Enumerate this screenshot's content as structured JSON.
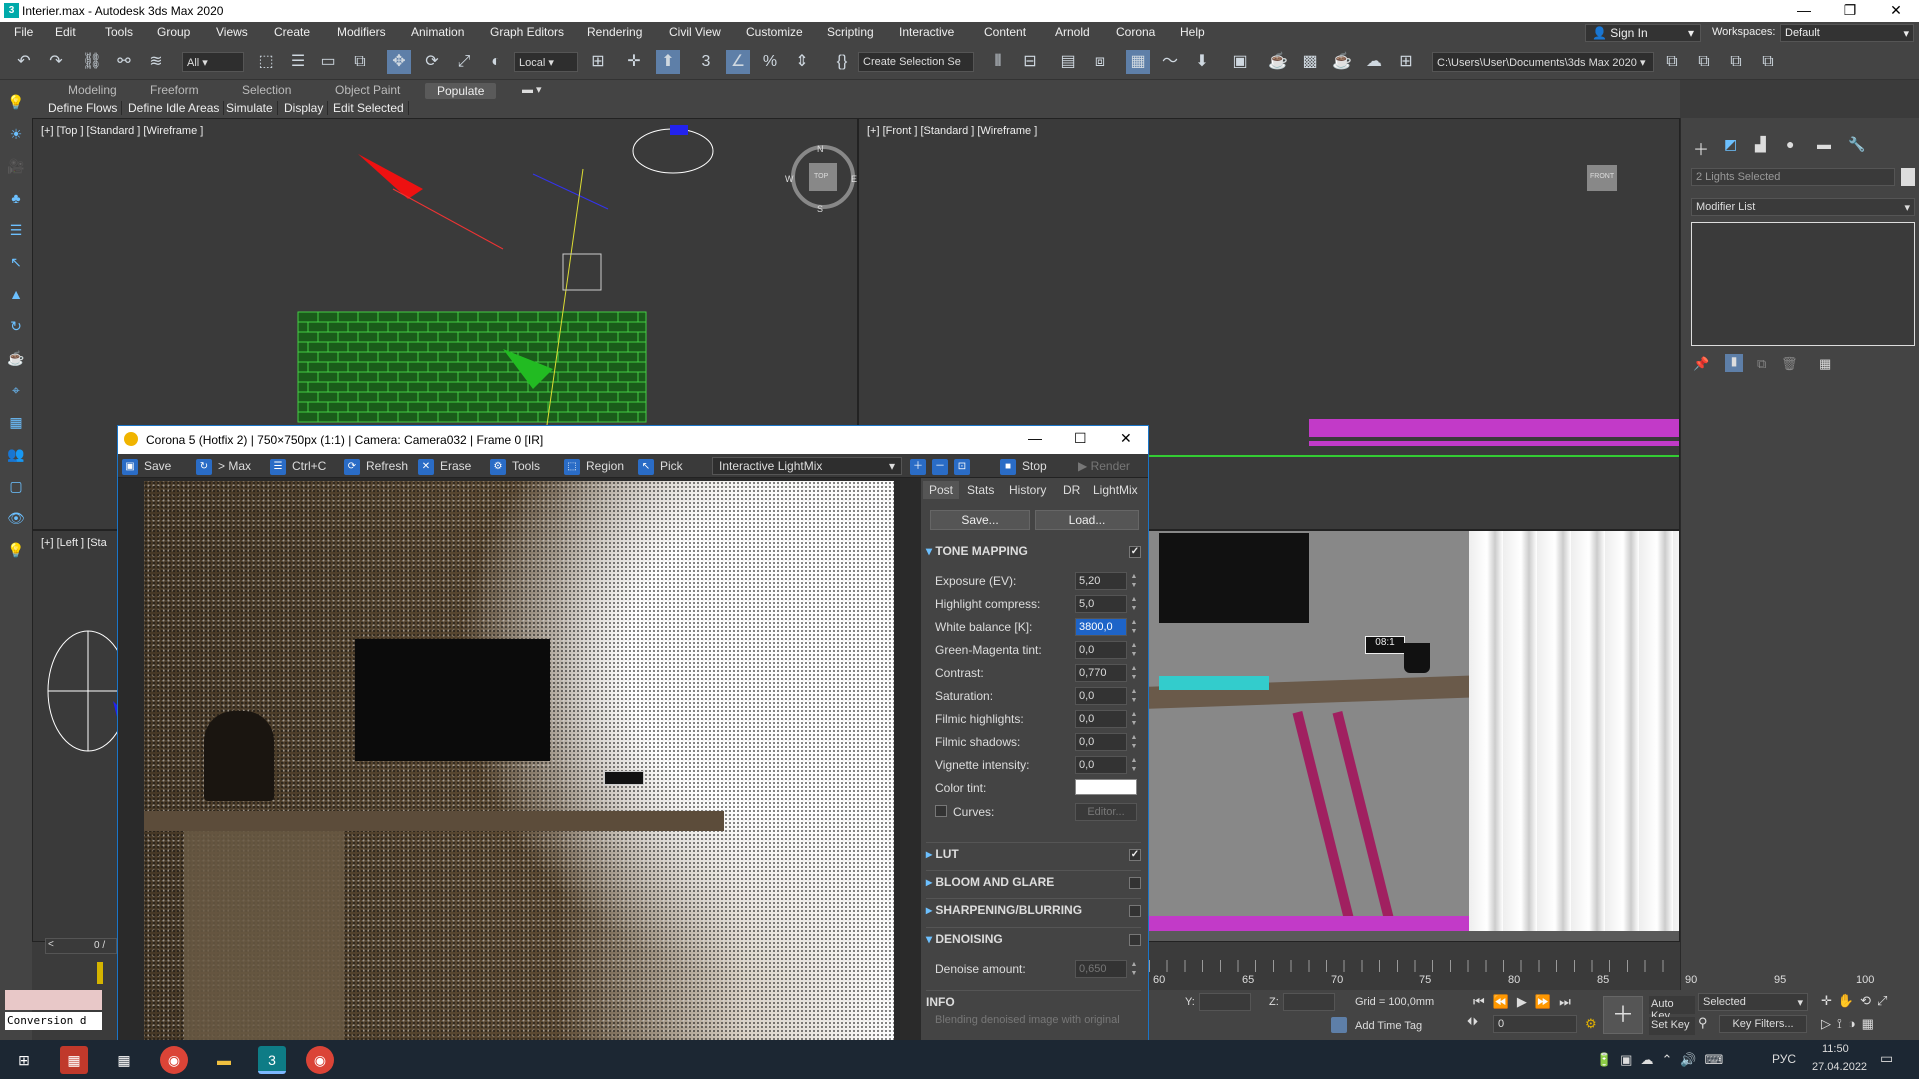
{
  "app": {
    "title": "Interier.max - Autodesk 3ds Max 2020",
    "window_controls": {
      "minimize": "—",
      "restore": "❐",
      "close": "✕"
    }
  },
  "menubar": {
    "items": [
      "File",
      "Edit",
      "Tools",
      "Group",
      "Views",
      "Create",
      "Modifiers",
      "Animation",
      "Graph Editors",
      "Rendering",
      "Civil View",
      "Customize",
      "Scripting",
      "Interactive",
      "Content",
      "Arnold",
      "Corona",
      "Help"
    ],
    "sign_in": "Sign In",
    "workspaces_label": "Workspaces:",
    "workspaces_value": "Default"
  },
  "toolbar": {
    "filter": "All",
    "coord": "Local",
    "selection_set": "Create Selection Se",
    "project_path": "C:\\Users\\User\\Documents\\3ds Max 2020"
  },
  "ribbon": {
    "tabs": [
      "Modeling",
      "Freeform",
      "Selection",
      "Object Paint",
      "Populate"
    ],
    "active_tab": "Populate",
    "sub_items": [
      "Define Flows",
      "Define Idle Areas",
      "Simulate",
      "Display",
      "Edit Selected"
    ]
  },
  "viewports": {
    "top": "[+] [Top ] [Standard ] [Wireframe ]",
    "front": "[+] [Front ] [Standard ] [Wireframe ]",
    "left": "[+] [Left ] [Sta",
    "compass": {
      "n": "N",
      "s": "S",
      "w": "W",
      "e": "E",
      "cube": "TOP"
    },
    "front_cube": "FRONT"
  },
  "cmdpanel": {
    "selection": "2 Lights Selected",
    "modifier_list": "Modifier List"
  },
  "corona": {
    "title": "Corona 5 (Hotfix 2) | 750×750px (1:1) | Camera: Camera032 | Frame 0 [IR]",
    "toolbar": {
      "save": "Save",
      "to_max": "> Max",
      "copy": "Ctrl+C",
      "refresh": "Refresh",
      "erase": "Erase",
      "tools": "Tools",
      "region": "Region",
      "pick": "Pick",
      "lightmix": "Interactive LightMix",
      "stop": "Stop",
      "render": "Render"
    },
    "tabs": [
      "Post",
      "Stats",
      "History",
      "DR",
      "LightMix"
    ],
    "active_tab": "Post",
    "buttons": {
      "save": "Save...",
      "load": "Load..."
    },
    "tone_mapping": {
      "title": "TONE MAPPING",
      "enabled": true,
      "rows": [
        {
          "label": "Exposure (EV):",
          "value": "5,20"
        },
        {
          "label": "Highlight compress:",
          "value": "5,0"
        },
        {
          "label": "White balance [K]:",
          "value": "3800,0"
        },
        {
          "label": "Green-Magenta tint:",
          "value": "0,0"
        },
        {
          "label": "Contrast:",
          "value": "0,770"
        },
        {
          "label": "Saturation:",
          "value": "0,0"
        },
        {
          "label": "Filmic highlights:",
          "value": "0,0"
        },
        {
          "label": "Filmic shadows:",
          "value": "0,0"
        },
        {
          "label": "Vignette intensity:",
          "value": "0,0"
        }
      ],
      "color_tint_label": "Color tint:",
      "curves_label": "Curves:",
      "editor_label": "Editor..."
    },
    "sections": [
      {
        "title": "LUT",
        "enabled": true
      },
      {
        "title": "BLOOM AND GLARE",
        "enabled": false
      },
      {
        "title": "SHARPENING/BLURRING",
        "enabled": false
      },
      {
        "title": "DENOISING",
        "enabled": false
      }
    ],
    "denoise_label": "Denoise amount:",
    "denoise_value": "0,650",
    "info_title": "INFO",
    "info_text": "Blending denoised image with original"
  },
  "timeline": {
    "ticks": [
      "60",
      "65",
      "70",
      "75",
      "80",
      "85",
      "90",
      "95",
      "100"
    ],
    "frame_counter": "0 /"
  },
  "status": {
    "y_label": "Y:",
    "z_label": "Z:",
    "grid": "Grid = 100,0mm",
    "add_time_tag": "Add Time Tag",
    "auto_key": "Auto Key",
    "set_key": "Set Key",
    "selected": "Selected",
    "key_filters": "Key Filters...",
    "frame_value": "0",
    "conversion": "Conversion d"
  },
  "taskbar": {
    "lang": "РУС",
    "time": "11:50",
    "date": "27.04.2022"
  }
}
